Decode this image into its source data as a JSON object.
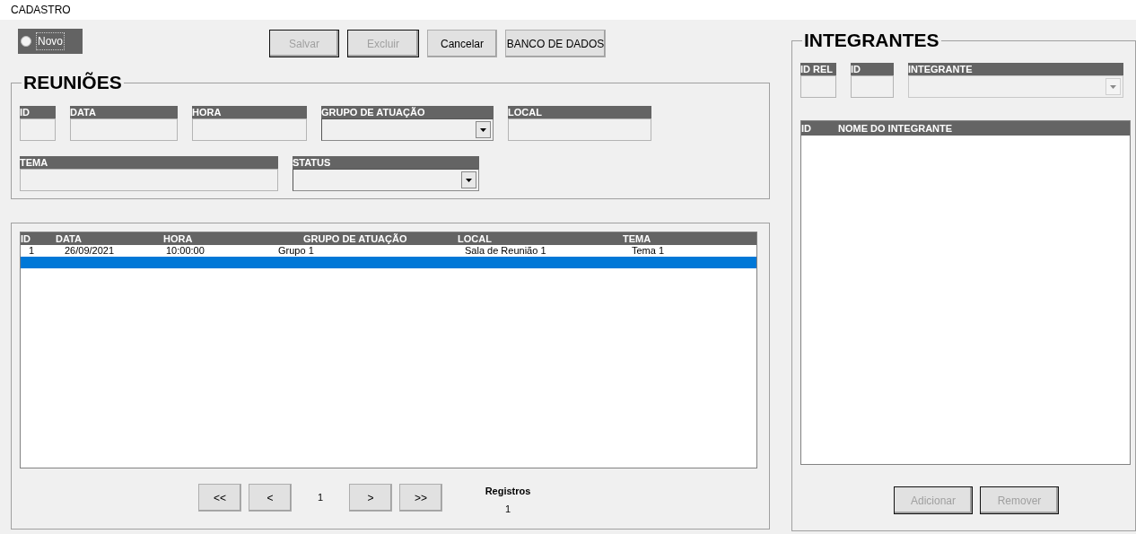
{
  "window": {
    "title": "CADASTRO"
  },
  "novo": {
    "label": "Novo",
    "checked": false
  },
  "toolbar": [
    {
      "label": "Salvar",
      "disabled": true
    },
    {
      "label": "Excluir",
      "disabled": true
    },
    {
      "label": "Cancelar",
      "disabled": false
    },
    {
      "label": "BANCO DE DADOS",
      "disabled": false
    }
  ],
  "reunioes": {
    "title": "REUNIÕES",
    "row_1": [
      {
        "label": "ID",
        "kind": "text"
      },
      {
        "label": "DATA",
        "kind": "text"
      },
      {
        "label": "HORA",
        "kind": "text"
      },
      {
        "label": "GRUPO DE ATUAÇÃO",
        "kind": "combo",
        "disabled": false
      },
      {
        "label": "LOCAL",
        "kind": "text"
      }
    ],
    "row_2": [
      {
        "label": "TEMA",
        "kind": "text"
      },
      {
        "label": "STATUS",
        "kind": "combo",
        "disabled": false
      }
    ]
  },
  "table": {
    "columns": [
      "ID",
      "DATA",
      "HORA",
      "GRUPO DE ATUAÇÃO",
      "LOCAL",
      "TEMA"
    ],
    "rows": [
      {
        "cells": [
          "1",
          "26/09/2021",
          "10:00:00",
          "Grupo 1",
          "Sala de Reunião 1",
          "Tema 1"
        ],
        "selected": false
      },
      {
        "selected": true
      }
    ]
  },
  "pager": {
    "first": "<<",
    "prev": "<",
    "page": "1",
    "next": ">",
    "last": ">>",
    "count_label": "Registros",
    "count": "1"
  },
  "integrantes": {
    "title": "INTEGRANTES",
    "fields": [
      {
        "label": "ID REL",
        "kind": "text"
      },
      {
        "label": "ID",
        "kind": "text"
      },
      {
        "label": "INTEGRANTE",
        "kind": "combo",
        "disabled": true
      }
    ],
    "list_columns": [
      "ID",
      "NOME DO INTEGRANTE"
    ],
    "buttons": [
      {
        "label": "Adicionar",
        "disabled": true
      },
      {
        "label": "Remover",
        "disabled": true
      }
    ]
  }
}
